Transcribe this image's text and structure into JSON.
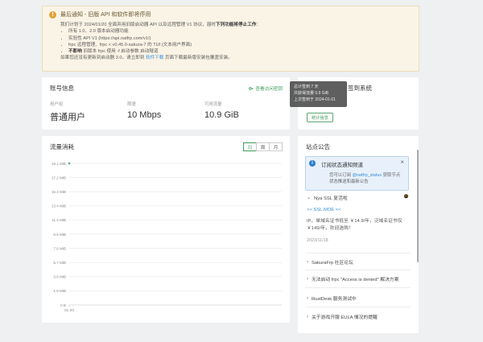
{
  "notice": {
    "title": "最后通知 - 旧版 API 和软件即将停用",
    "line1_pre": "我们计划于 2024/01/20 全面弃用旧版启动器 API 以及远程管理 V1 协议，届时",
    "line1_bold": "下列功能将停止工作",
    "line1_post": "：",
    "items": [
      "所有 1.0、2.0 版本启动器功能",
      "实验性 API V1 (https://api.natfrp.com/v1/)",
      "frpc 远程管理、frpc < v0.45.0-sakura-7 的 TUI (文本用户界面)"
    ],
    "item4_bold": "不影响",
    "item4_rest": " 旧版本 frpc 使用 -f 启动参数 启动隧道",
    "footer_pre": "如果您还没有更新到启动器 3.0，请立即到 ",
    "footer_link": "软件下载",
    "footer_post": " 页面下载最新版安装包覆盖安装。"
  },
  "account": {
    "title": "账号信息",
    "link": "查看访问密钥",
    "fields": [
      {
        "label": "用户组",
        "value": "普通用户"
      },
      {
        "label": "限速",
        "value": "10 Mbps"
      },
      {
        "label": "可用流量",
        "value": "10.9 GiB"
      }
    ]
  },
  "sign": {
    "title": "签到系统",
    "tooltip": [
      "总计签到 7 天",
      "共获得流量 5.9 GiB",
      "上次签到于 2024-01-01"
    ],
    "button": "统计信息"
  },
  "traffic": {
    "title": "流量消耗",
    "tabs": [
      "日",
      "周",
      "月"
    ],
    "active_tab": 0
  },
  "chart_data": {
    "type": "line",
    "categories": [
      "01-20"
    ],
    "values": [
      19.1
    ],
    "yticks": [
      "19.1 MiB",
      "17.2 MiB",
      "15.3 MiB",
      "13.4 MiB",
      "11.4 MiB",
      "9.5 MiB",
      "7.6 MiB",
      "5.7 MiB",
      "3.8 MiB",
      "1.9 MiB",
      "0 B"
    ],
    "ylim": [
      0,
      19.1
    ],
    "ylabel": "",
    "xlabel": "",
    "color": "#4cae6e"
  },
  "announce": {
    "title": "站点公告",
    "sub_title": "订阅状态通知频道",
    "sub_desc_pre": "您可以订阅 ",
    "sub_desc_link": "@natfrp_status",
    "sub_desc_post": " 获取节点状态推送和最新公告",
    "expanded_title": "Nya SSL 复活啦",
    "expanded_link": ">> SSL.MOE <<",
    "expanded_text": "IP、单域名证书低至 ￥14.9/年，泛域名证书仅 ￥149/年，欢迎选购！",
    "expanded_date": "2023/11/18",
    "items": [
      "SakuraFrp 社区论坛",
      "无法启动 frpc \"Access is denied\" 解决方案",
      "RustDesk 服务测试中",
      "关于游戏开服 EULA 情况的提醒"
    ]
  }
}
